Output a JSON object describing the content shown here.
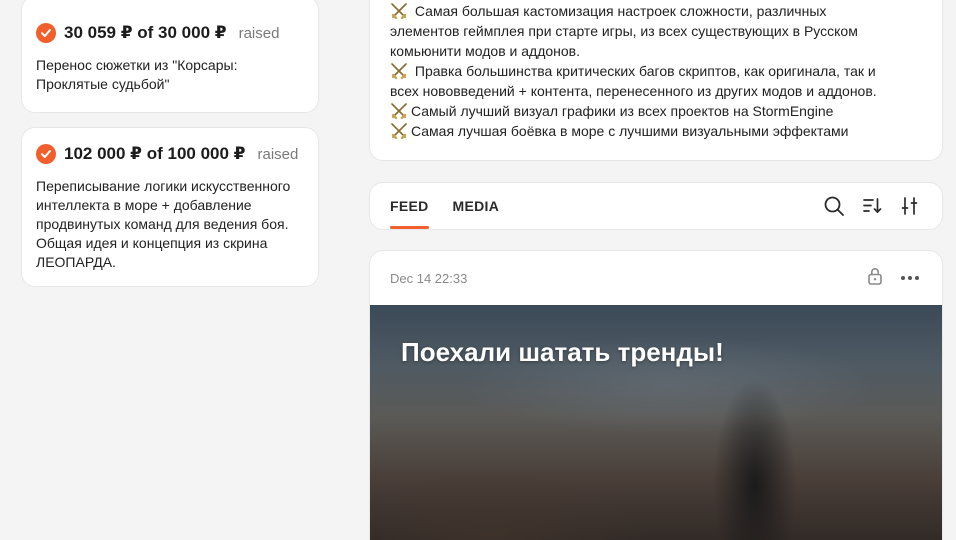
{
  "goals": [
    {
      "amount": "30 059 ₽ of 30 000 ₽",
      "raised_label": "raised",
      "description": "Перенос сюжетки из \"Корсары: Проклятые судьбой\""
    },
    {
      "amount": "102 000 ₽ of 100 000 ₽",
      "raised_label": "raised",
      "description": "Переписывание логики искусственного интеллекта в море + добавление продвинутых команд для ведения боя. Общая идея и концепция из скрина ЛЕОПАРДА."
    }
  ],
  "description": {
    "lines": [
      " Самая большая кастомизация настроек сложности, различных",
      "элементов геймплея при старте игры, из всех существующих в Русском",
      "комьюнити модов и аддонов.",
      " Правка большинства критических багов скриптов, как оригинала, так и",
      "всех нововведений + контента, перенесенного из других модов и аддонов.",
      "Самый лучший визуал графики из всех проектов на StormEngine",
      "Самая лучшая боёвка в море с лучшими визуальными эффектами"
    ]
  },
  "tabs": {
    "feed": "FEED",
    "media": "MEDIA"
  },
  "post": {
    "date": "Dec 14 22:33",
    "title": "Поехали шатать тренды!"
  },
  "colors": {
    "accent": "#f15f2c",
    "background": "#f4f4f4"
  },
  "icons": {
    "goal_status": "check-icon",
    "bullet": "crossed-swords-icon",
    "search": "search-icon",
    "sort": "sort-icon",
    "filter": "filter-icon",
    "lock": "lock-icon",
    "more": "more-icon"
  }
}
